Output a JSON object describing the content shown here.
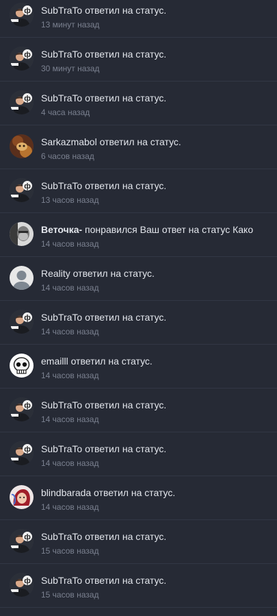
{
  "notifications": [
    {
      "user": "SubTraTo",
      "action": " ответил на статус.",
      "time": "13 минут назад",
      "avatar": "subtrato-avatar",
      "bold": false
    },
    {
      "user": "SubTraTo",
      "action": " ответил на статус.",
      "time": "30 минут назад",
      "avatar": "subtrato-avatar",
      "bold": false
    },
    {
      "user": "SubTraTo",
      "action": " ответил на статус.",
      "time": "4 часа назад",
      "avatar": "subtrato-avatar",
      "bold": false
    },
    {
      "user": "Sarkazmabol",
      "action": " ответил на статус.",
      "time": "6 часов назад",
      "avatar": "sarkazmabol-avatar",
      "bold": false
    },
    {
      "user": "SubTraTo",
      "action": " ответил на статус.",
      "time": "13 часов назад",
      "avatar": "subtrato-avatar",
      "bold": false
    },
    {
      "user": "Веточка-",
      "action": " понравился Ваш ответ на статус Како",
      "time": "14 часов назад",
      "avatar": "vetochka-avatar",
      "bold": true
    },
    {
      "user": "Reality",
      "action": " ответил на статус.",
      "time": "14 часов назад",
      "avatar": "default-avatar",
      "bold": false
    },
    {
      "user": "SubTraTo",
      "action": " ответил на статус.",
      "time": "14 часов назад",
      "avatar": "subtrato-avatar",
      "bold": false
    },
    {
      "user": "emailll",
      "action": " ответил на статус.",
      "time": "14 часов назад",
      "avatar": "skull-avatar",
      "bold": false
    },
    {
      "user": "SubTraTo",
      "action": " ответил на статус.",
      "time": "14 часов назад",
      "avatar": "subtrato-avatar",
      "bold": false
    },
    {
      "user": "SubTraTo",
      "action": " ответил на статус.",
      "time": "14 часов назад",
      "avatar": "subtrato-avatar",
      "bold": false
    },
    {
      "user": "blindbarada",
      "action": " ответил на статус.",
      "time": "14 часов назад",
      "avatar": "blindbarada-avatar",
      "bold": false
    },
    {
      "user": "SubTraTo",
      "action": " ответил на статус.",
      "time": "15 часов назад",
      "avatar": "subtrato-avatar",
      "bold": false
    },
    {
      "user": "SubTraTo",
      "action": " ответил на статус.",
      "time": "15 часов назад",
      "avatar": "subtrato-avatar",
      "bold": false
    }
  ],
  "colors": {
    "background": "#262a35",
    "divider": "#323745",
    "text": "#e3e6ec",
    "time": "#7b8190"
  }
}
